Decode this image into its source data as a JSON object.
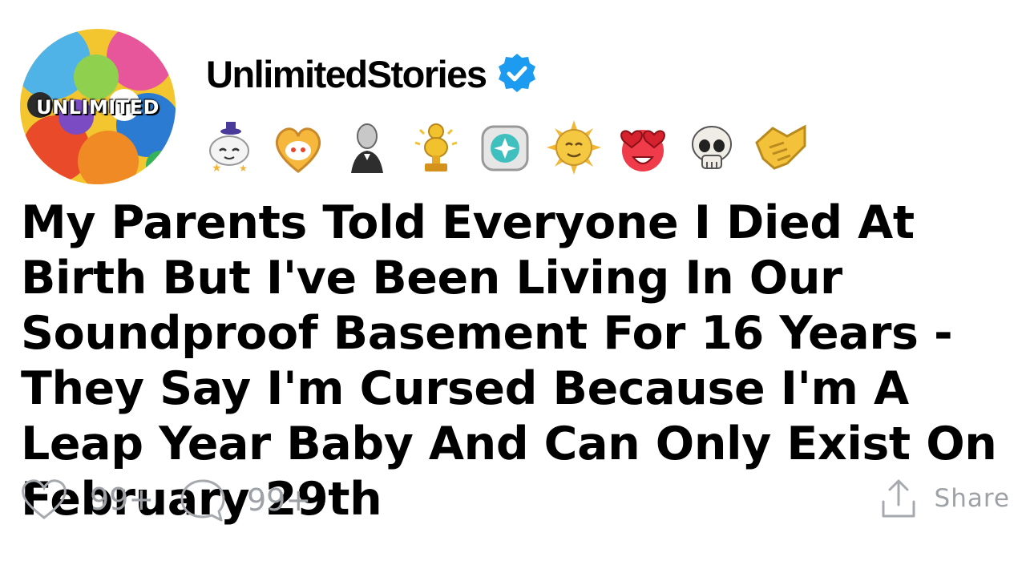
{
  "profile": {
    "avatar_text": "UNLIMITED",
    "username": "UnlimitedStories",
    "verified_icon": "verified-check-icon"
  },
  "badges": [
    {
      "icon": "angel-snoo-icon"
    },
    {
      "icon": "heart-snoo-icon"
    },
    {
      "icon": "gentleman-icon"
    },
    {
      "icon": "gold-trophy-icon"
    },
    {
      "icon": "diamond-gem-icon"
    },
    {
      "icon": "wholesome-sun-icon"
    },
    {
      "icon": "heart-eyes-icon"
    },
    {
      "icon": "skull-icon"
    },
    {
      "icon": "handshake-icon"
    }
  ],
  "post": {
    "title": "My Parents Told Everyone I Died At Birth But I've Been Living In Our Soundproof Basement For 16 Years - They Say I'm Cursed Because I'm A Leap Year Baby And Can Only Exist On February 29th"
  },
  "actions": {
    "likes": "99+",
    "comments": "99+",
    "share_label": "Share"
  },
  "colors": {
    "verified_blue": "#1d9bf0",
    "muted_gray": "#9ea2a6"
  }
}
